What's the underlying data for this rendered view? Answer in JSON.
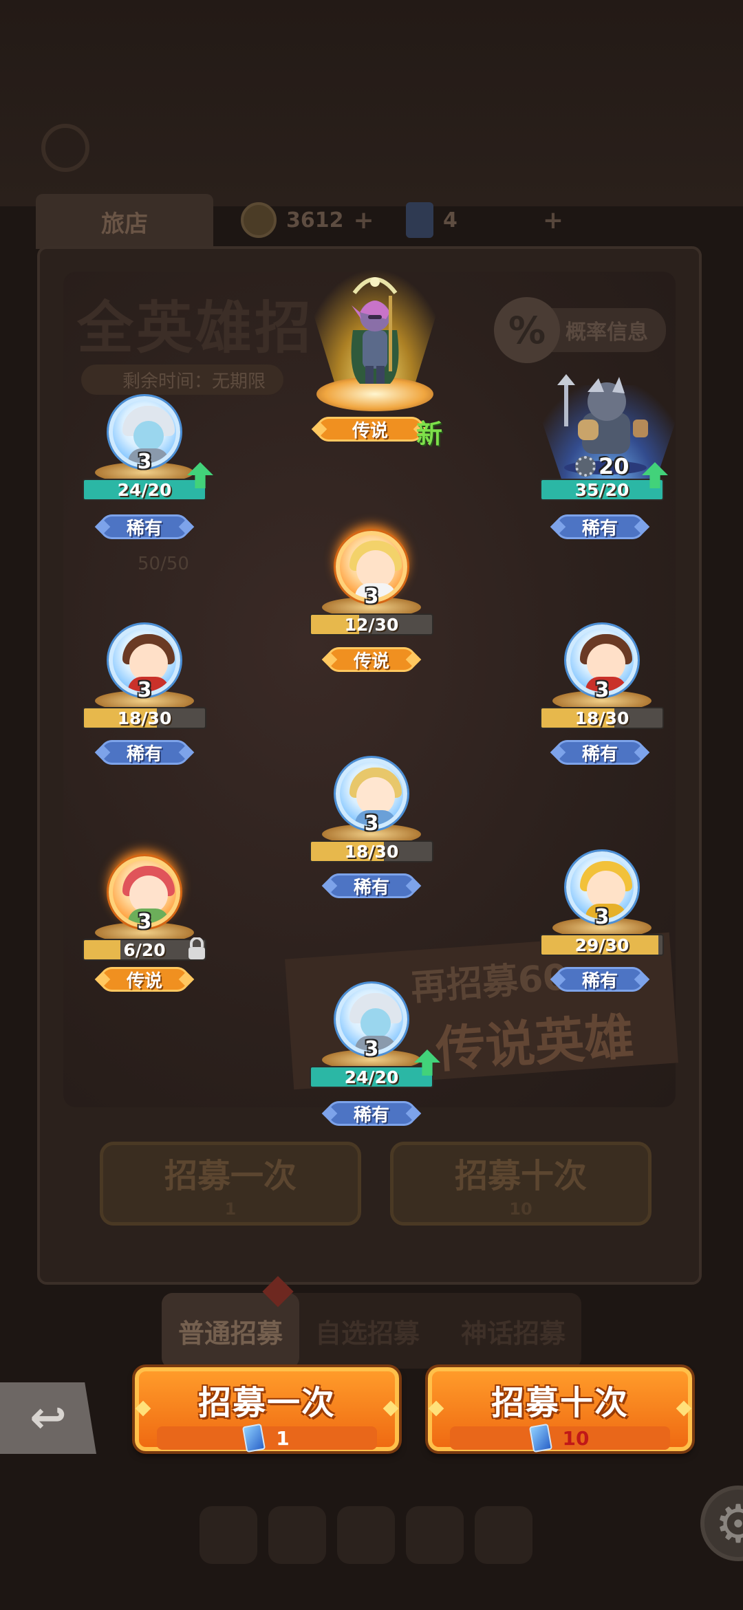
{
  "background": {
    "shop_tab": "旅店",
    "gold": "3612",
    "tickets": "4",
    "banner_title": "全英雄招",
    "timer_text": "剩余时间：无期限",
    "rate_info": "概率信息",
    "hero_count": "50/50",
    "promo_line1": "再招募60",
    "promo_line2": "传说英雄",
    "btn_once": "招募一次",
    "btn_once_cost": "1",
    "btn_ten": "招募十次",
    "btn_ten_cost": "10",
    "tab_normal": "普通招募",
    "tab_choice": "自选招募",
    "tab_event": "神话招募"
  },
  "featured": {
    "rarity": "传说",
    "new_label": "新"
  },
  "heroes": [
    {
      "id": "h1",
      "level": "3",
      "fragments": "24/20",
      "progress": 1.0,
      "rarity": "稀有",
      "type": "rare",
      "can_upgrade": true
    },
    {
      "id": "boss",
      "level": "20",
      "fragments": "35/20",
      "progress": 1.0,
      "rarity": "稀有",
      "type": "rare",
      "can_upgrade": true
    },
    {
      "id": "h2",
      "level": "3",
      "fragments": "12/30",
      "progress": 0.4,
      "rarity": "传说",
      "type": "legend",
      "can_upgrade": false
    },
    {
      "id": "h3",
      "level": "3",
      "fragments": "18/30",
      "progress": 0.6,
      "rarity": "稀有",
      "type": "rare",
      "can_upgrade": false
    },
    {
      "id": "h4",
      "level": "3",
      "fragments": "18/30",
      "progress": 0.6,
      "rarity": "稀有",
      "type": "rare",
      "can_upgrade": false
    },
    {
      "id": "h5",
      "level": "3",
      "fragments": "18/30",
      "progress": 0.6,
      "rarity": "稀有",
      "type": "rare",
      "can_upgrade": false
    },
    {
      "id": "h6",
      "level": "3",
      "fragments": "6/20",
      "progress": 0.3,
      "rarity": "传说",
      "type": "legend",
      "can_upgrade": false,
      "locked": true
    },
    {
      "id": "h7",
      "level": "3",
      "fragments": "29/30",
      "progress": 0.967,
      "rarity": "稀有",
      "type": "rare",
      "can_upgrade": false
    },
    {
      "id": "h8",
      "level": "3",
      "fragments": "24/20",
      "progress": 1.0,
      "rarity": "稀有",
      "type": "rare",
      "can_upgrade": true
    }
  ],
  "actions": {
    "recruit_once": {
      "label": "招募一次",
      "cost": "1"
    },
    "recruit_ten": {
      "label": "招募十次",
      "cost": "10"
    }
  },
  "colors": {
    "rare": "#4d74c4",
    "legend": "#f09020",
    "fragment_fill": "#e7b84c",
    "fragment_full": "#2bb7a5",
    "ten_cost_text": "#c01818"
  },
  "icons": {
    "back": "back-arrow-icon",
    "settings": "gear-icon",
    "ticket": "ticket-icon",
    "upgrade": "up-arrow-icon",
    "lock": "lock-icon"
  }
}
